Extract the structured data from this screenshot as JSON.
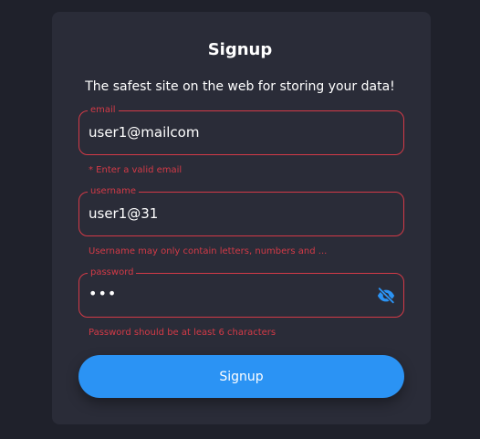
{
  "form": {
    "title": "Signup",
    "subtitle": "The safest site on the web for storing your data!",
    "email": {
      "label": "email",
      "value": "user1@mailcom",
      "error": "* Enter a valid email"
    },
    "username": {
      "label": "username",
      "value": "user1@31",
      "error": "Username may only contain letters, numbers and ..."
    },
    "password": {
      "label": "password",
      "value": "•••",
      "error": "Password should be at least 6 characters",
      "toggle_icon": "eye-off-icon"
    },
    "submit_label": "Signup"
  },
  "colors": {
    "background": "#1f212b",
    "card": "#2a2c38",
    "error": "#d33a47",
    "accent": "#2b93f4",
    "text": "#ffffff"
  }
}
